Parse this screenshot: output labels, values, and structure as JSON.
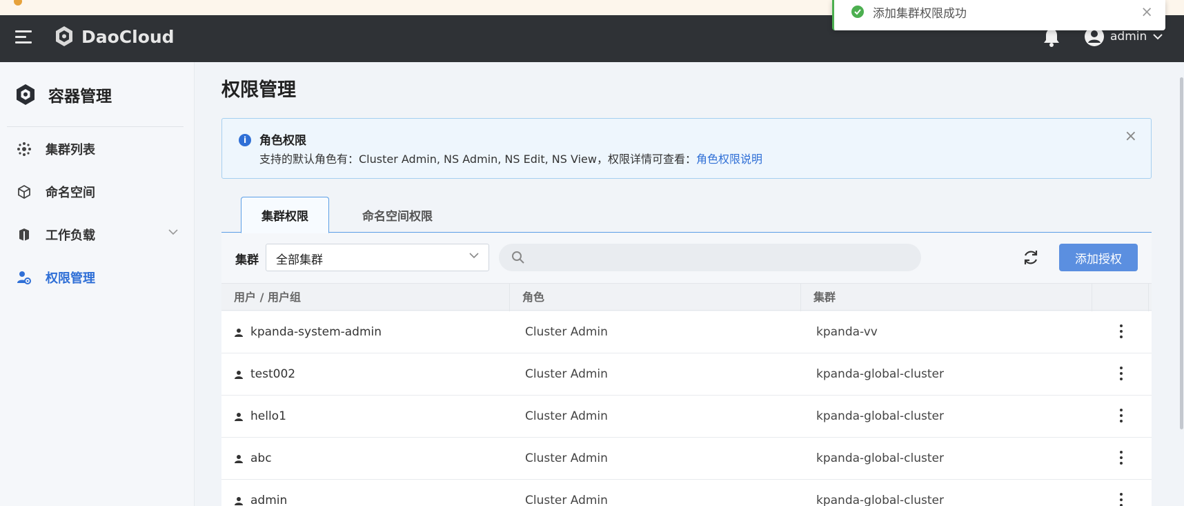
{
  "app": {
    "brand": "DaoCloud"
  },
  "topbar": {
    "username": "admin"
  },
  "toast": {
    "message": "添加集群权限成功",
    "close": "×"
  },
  "sidebar": {
    "title": "容器管理",
    "items": [
      {
        "label": "集群列表",
        "icon": "cluster-icon"
      },
      {
        "label": "命名空间",
        "icon": "namespace-icon"
      },
      {
        "label": "工作负载",
        "icon": "workload-icon",
        "expandable": true
      },
      {
        "label": "权限管理",
        "icon": "permission-icon",
        "active": true
      }
    ]
  },
  "page": {
    "title": "权限管理"
  },
  "alert": {
    "title": "角色权限",
    "description": "支持的默认角色有：Cluster Admin, NS Admin, NS Edit, NS View，权限详情可查看：",
    "link": "角色权限说明",
    "close": "×"
  },
  "tabs": [
    {
      "label": "集群权限",
      "active": true
    },
    {
      "label": "命名空间权限",
      "active": false
    }
  ],
  "filter": {
    "label": "集群",
    "selected": "全部集群",
    "search_placeholder": ""
  },
  "actions": {
    "add_label": "添加授权"
  },
  "table": {
    "columns": [
      "用户 / 用户组",
      "角色",
      "集群"
    ],
    "rows": [
      {
        "user": "kpanda-system-admin",
        "role": "Cluster Admin",
        "cluster": "kpanda-vv"
      },
      {
        "user": "test002",
        "role": "Cluster Admin",
        "cluster": "kpanda-global-cluster"
      },
      {
        "user": "hello1",
        "role": "Cluster Admin",
        "cluster": "kpanda-global-cluster"
      },
      {
        "user": "abc",
        "role": "Cluster Admin",
        "cluster": "kpanda-global-cluster"
      },
      {
        "user": "admin",
        "role": "Cluster Admin",
        "cluster": "kpanda-global-cluster"
      }
    ]
  },
  "colors": {
    "accent": "#2f6fd6",
    "topbar": "#2f3236",
    "success": "#4caf50",
    "button": "#5b8fe0"
  }
}
